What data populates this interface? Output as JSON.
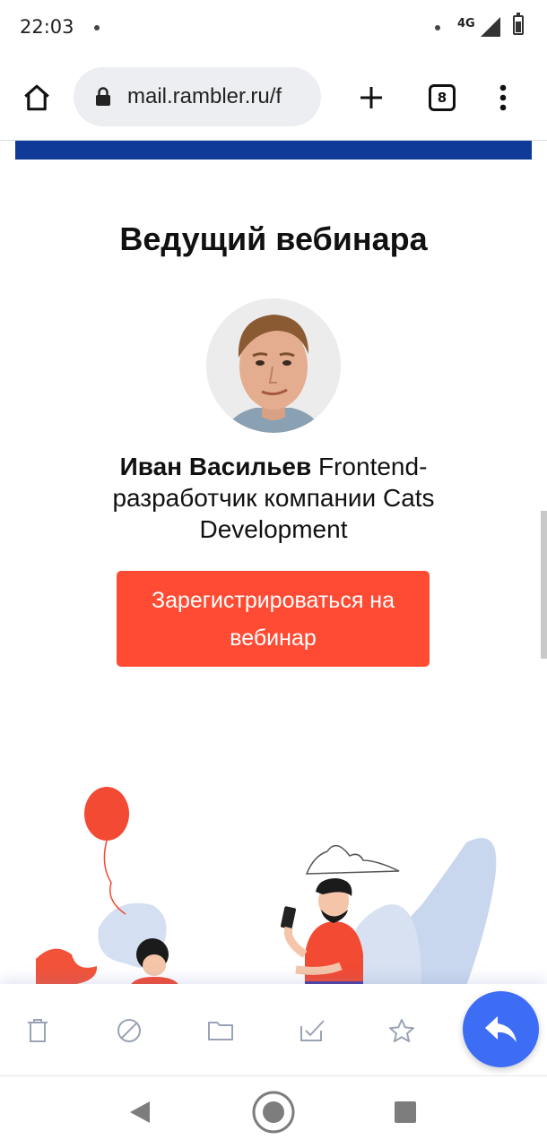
{
  "status_bar": {
    "time": "22:03",
    "network": "4G"
  },
  "browser": {
    "url": "mail.rambler.ru/f",
    "tab_count": "8"
  },
  "email": {
    "heading": "Ведущий вебинара",
    "speaker_name": "Иван Васильев",
    "speaker_role": " Frontend-разработчик компании Cats Development",
    "cta_label": "Зарегистрироваться на вебинар"
  },
  "colors": {
    "brand_blue": "#0f3a98",
    "cta": "#ff4b33",
    "fab": "#3d6cf5"
  },
  "action_bar": {
    "icons": [
      "trash-icon",
      "block-icon",
      "folder-icon",
      "mark-read-icon",
      "star-icon"
    ],
    "fab_icon": "reply-icon"
  },
  "nav_bar": {
    "icons": [
      "back-icon",
      "home-icon",
      "recents-icon"
    ]
  }
}
